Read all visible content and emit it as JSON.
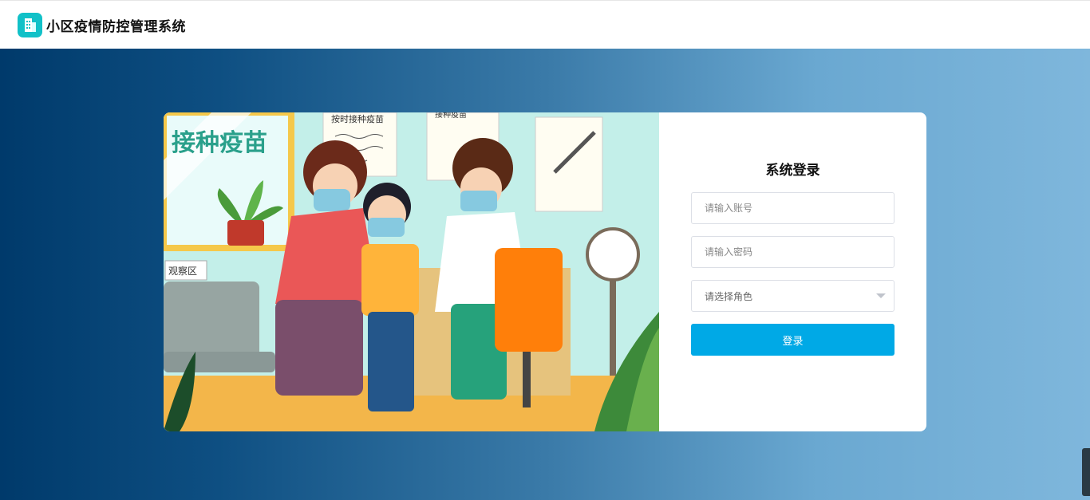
{
  "header": {
    "title": "小区疫情防控管理系统",
    "logo_icon": "building-icon"
  },
  "login": {
    "title": "系统登录",
    "account_placeholder": "请输入账号",
    "password_placeholder": "请输入密码",
    "role_placeholder": "请选择角色",
    "submit_label": "登录"
  },
  "illustration": {
    "banner_text": "接种疫苗",
    "poster1_text": "按时接种疫苗",
    "poster2_text": "接种疫苗",
    "sign_text": "观察区"
  },
  "colors": {
    "accent": "#00a9e6",
    "logo": "#11c1c8",
    "bg_dark": "#003a6b",
    "bg_light": "#7fb7dc"
  }
}
